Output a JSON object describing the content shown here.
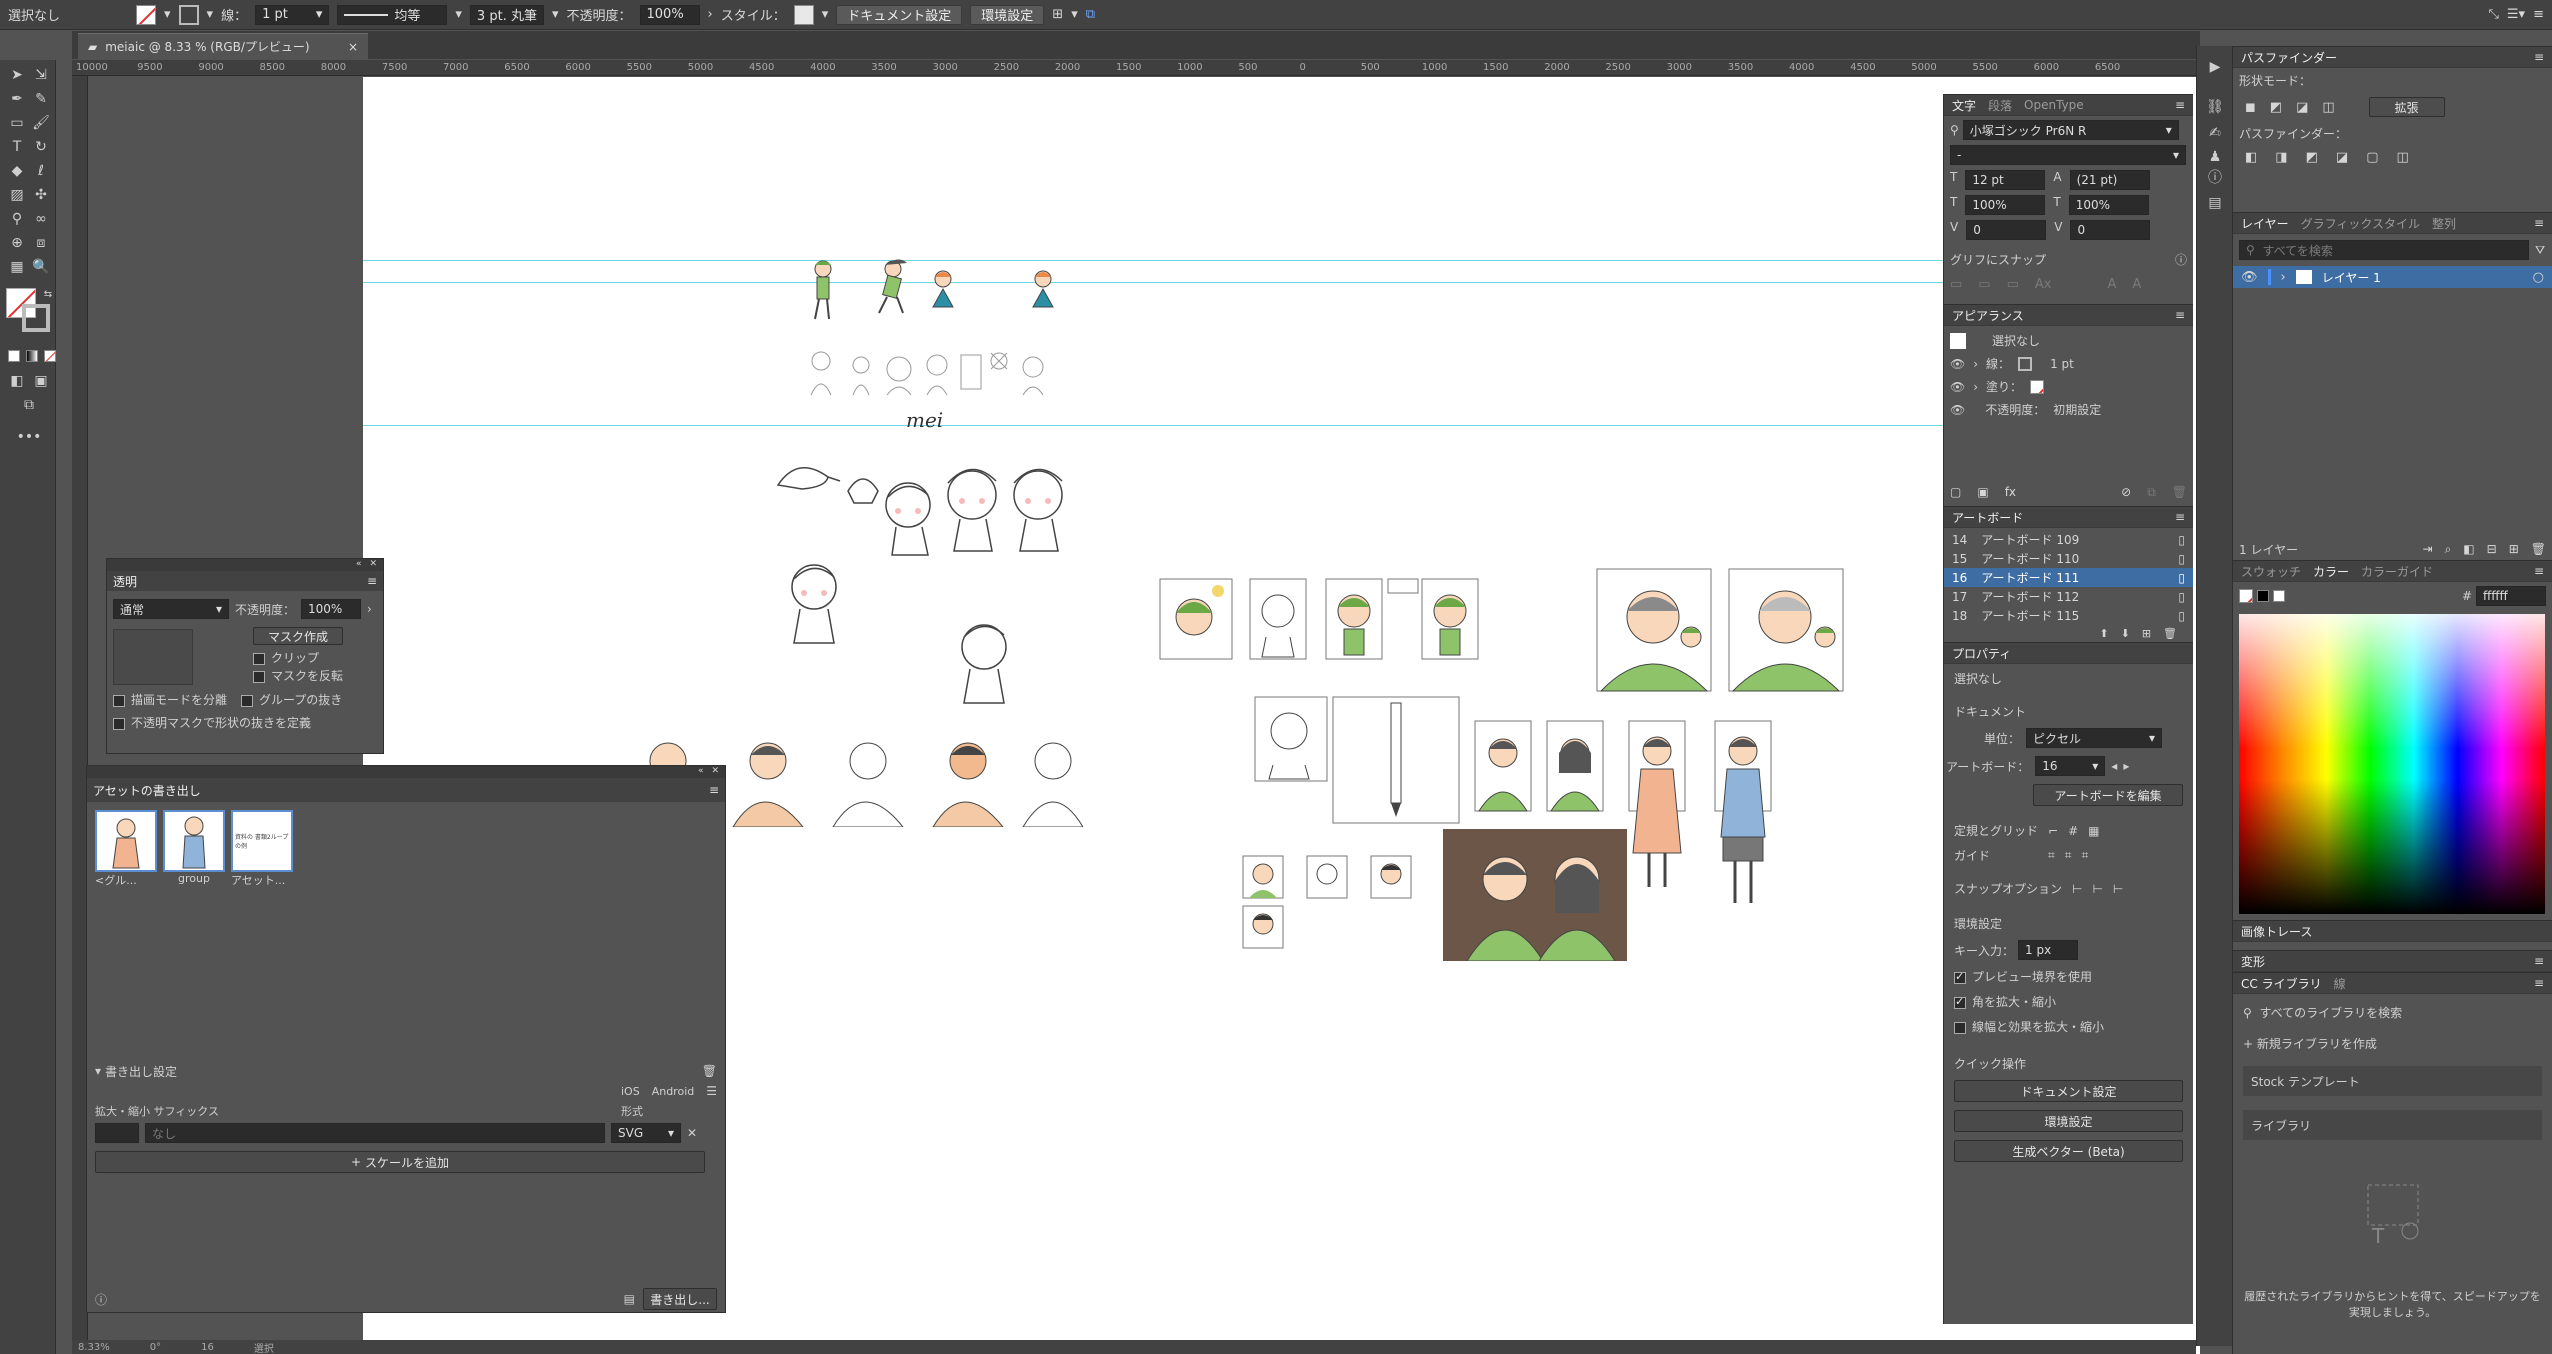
{
  "controlbar": {
    "selection": "選択なし",
    "stroke_label": "線：",
    "stroke_weight": "1 pt",
    "line_profile": "均等",
    "brush": "3 pt. 丸筆",
    "opacity_label": "不透明度：",
    "opacity_value": "100%",
    "style_label": "スタイル：",
    "doc_setup_button": "ドキュメント設定",
    "prefs_button": "環境設定"
  },
  "document_tab": {
    "title": "meiaic @ 8.33 % (RGB/プレビュー)",
    "close": "×"
  },
  "ruler_ticks": [
    "10000",
    "9500",
    "9000",
    "8500",
    "8000",
    "7500",
    "7000",
    "6500",
    "6000",
    "5500",
    "5000",
    "4500",
    "4000",
    "3500",
    "3000",
    "2500",
    "2000",
    "1500",
    "1000",
    "500",
    "0",
    "500",
    "1000",
    "1500",
    "2000",
    "2500",
    "3000",
    "3500",
    "4000",
    "4500",
    "5000",
    "5500",
    "6000",
    "6500"
  ],
  "canvas": {
    "artwork_text": "mei"
  },
  "transparency_panel": {
    "title": "透明",
    "blend_mode": "通常",
    "opacity_label": "不透明度：",
    "opacity_value": "100%",
    "make_mask": "マスク作成",
    "clip": "クリップ",
    "invert_mask": "マスクを反転",
    "isolate_blending": "描画モードを分離",
    "knockout_group": "グループの抜き",
    "opacity_mask_knockout": "不透明マスクで形状の抜きを定義"
  },
  "asset_export_panel": {
    "title": "アセットの書き出し",
    "assets": [
      {
        "label": "<グル..."
      },
      {
        "label": "group"
      },
      {
        "label": "アセット..."
      }
    ],
    "asset3_inner_text": "資料の 書類2ループの例",
    "export_settings": "書き出し設定",
    "ios": "iOS",
    "android": "Android",
    "scale_suffix_label": "拡大・縮小 サフィックス",
    "format_label": "形式",
    "suffix_placeholder": "なし",
    "format_value": "SVG",
    "add_scale": "スケールを追加",
    "export_button": "書き出し..."
  },
  "character_panel": {
    "tabs": [
      "文字",
      "段落",
      "OpenType"
    ],
    "font_family": "小塚ゴシック Pr6N R",
    "font_style": "-",
    "font_size": "12 pt",
    "leading": "(21 pt)",
    "vertical_scale": "100%",
    "horizontal_scale": "100%",
    "kerning": "0",
    "tracking": "0",
    "snap_to_glyph": "グリフにスナップ"
  },
  "appearance_panel": {
    "title": "アピアランス",
    "object": "選択なし",
    "stroke_label": "線：",
    "stroke_value": "1 pt",
    "fill_label": "塗り：",
    "opacity_label": "不透明度：",
    "opacity_value": "初期設定"
  },
  "artboards_panel": {
    "title": "アートボード",
    "rows": [
      {
        "num": "14",
        "name": "アートボード 109"
      },
      {
        "num": "15",
        "name": "アートボード 110"
      },
      {
        "num": "16",
        "name": "アートボード 111"
      },
      {
        "num": "17",
        "name": "アートボード 112"
      },
      {
        "num": "18",
        "name": "アートボード 115"
      }
    ]
  },
  "properties_panel": {
    "title": "プロパティ",
    "no_selection": "選択なし",
    "document": "ドキュメント",
    "unit_label": "単位：",
    "unit_value": "ピクセル",
    "artboard_label": "アートボード：",
    "artboard_value": "16",
    "edit_artboards": "アートボードを編集",
    "rulers_grids": "定規とグリッド",
    "guides": "ガイド",
    "snap_options": "スナップオプション",
    "preferences": "環境設定",
    "key_increment_label": "キー入力：",
    "key_increment_value": "1 px",
    "use_preview_bounds": "プレビュー境界を使用",
    "scale_corners": "角を拡大・縮小",
    "scale_strokes": "線幅と効果を拡大・縮小",
    "quick_actions": "クイック操作",
    "doc_setup_button": "ドキュメント設定",
    "prefs_button": "環境設定",
    "generative_vector": "生成ベクター (Beta)"
  },
  "pathfinder_panel": {
    "title": "パスファインダー",
    "shape_modes": "形状モード：",
    "expand": "拡張",
    "pathfinders": "パスファインダー："
  },
  "layers_panel": {
    "tabs": [
      "レイヤー",
      "グラフィックスタイル",
      "整列"
    ],
    "search_placeholder": "すべてを検索",
    "layer_name": "レイヤー 1",
    "layer_count": "1 レイヤー"
  },
  "color_panel": {
    "tabs": [
      "スウォッチ",
      "カラー",
      "カラーガイド"
    ],
    "hex_value": "ffffff"
  },
  "image_trace": {
    "title": "画像トレース"
  },
  "transform": {
    "title": "変形"
  },
  "libraries_panel": {
    "tabs": [
      "CC ライブラリ",
      "線"
    ],
    "search_placeholder": "すべてのライブラリを検索",
    "new_library": "新規ライブラリを作成",
    "stock_templates": "Stock テンプレート",
    "library": "ライブラリ",
    "hint": "履歴されたライブラリからヒントを得て、スピードアップを実現しましょう。"
  },
  "statusbar": {
    "zoom": "8.33%",
    "rotate": "0°",
    "artboard": "16",
    "tool": "選択"
  },
  "colors": {
    "green_shirt": "#8fc36a",
    "green_hair": "#6ca845",
    "skin": "#f8d7bb",
    "orange": "#e98a4a",
    "brown_bg": "#6b5648",
    "guide": "#6fd6e6",
    "selection_blue": "#3e6da3"
  }
}
